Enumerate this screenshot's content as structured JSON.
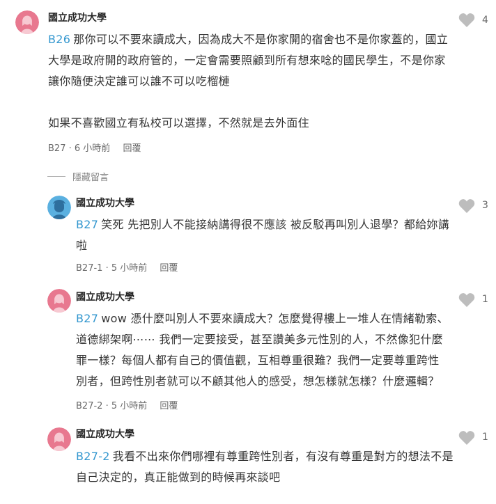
{
  "accent": "#3397cf",
  "heart_color": "#bdbdbd",
  "comments": [
    {
      "author": "國立成功大學",
      "avatar_color": "#e8788f",
      "likes": "4",
      "tag": "B26",
      "lines": [
        "那你可以不要來讀成大，因為成大不是你家開的宿舍也不是你家蓋的，國立",
        "大學是政府開的政府管的，一定會需要照顧到所有想來唸的國民學生，不是你家",
        "讓你隨便決定誰可以誰不可以吃榴槤",
        "",
        "如果不喜歡國立有私校可以選擇，不然就是去外面住"
      ],
      "floor": "B27",
      "time": "6 小時前",
      "reply": "回覆"
    },
    {
      "author": "國立成功大學",
      "avatar_color": "#5ab0e0",
      "likes": "3",
      "tag": "B27",
      "lines": [
        "笑死 先把別人不能接納講得很不應該 被反駁再叫別人退學？都給妳講",
        "啦"
      ],
      "floor": "B27-1",
      "time": "5 小時前",
      "reply": "回覆"
    },
    {
      "author": "國立成功大學",
      "avatar_color": "#e8788f",
      "likes": "1",
      "tag": "B27",
      "lines": [
        "wow 憑什麼叫別人不要來讀成大？怎麼覺得樓上一堆人在情緒勒索、",
        "道德綁架啊⋯⋯ 我們一定要接受，甚至讚美多元性別的人，不然像犯什麼",
        "罪一樣？每個人都有自己的價值觀，互相尊重很難？我們一定要尊重跨性",
        "別者，但跨性別者就可以不顧其他人的感受，想怎樣就怎樣？什麼邏輯？"
      ],
      "floor": "B27-2",
      "time": "5 小時前",
      "reply": "回覆"
    },
    {
      "author": "國立成功大學",
      "avatar_color": "#e8788f",
      "likes": "1",
      "tag": "B27-2",
      "lines": [
        "我看不出來你們哪裡有尊重跨性別者，有沒有尊重是對方的想法不是",
        "自己決定的，真正能做到的時候再來談吧"
      ],
      "floor": "",
      "time": "",
      "reply": ""
    }
  ],
  "hidden_label": "隱藏留言",
  "dot": "·"
}
